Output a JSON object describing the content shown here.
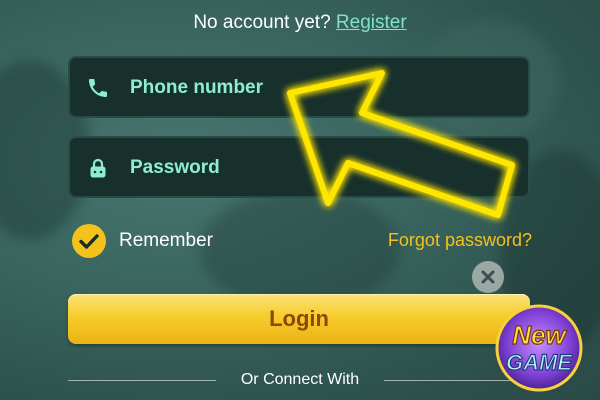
{
  "register": {
    "prompt": "No account yet?",
    "link": "Register"
  },
  "fields": {
    "phone": {
      "placeholder": "Phone number",
      "icon": "phone-icon"
    },
    "password": {
      "placeholder": "Password",
      "icon": "lock-icon"
    }
  },
  "remember": {
    "label": "Remember",
    "checked": true
  },
  "forgot": "Forgot password?",
  "login": "Login",
  "divider": "Or Connect With",
  "logo": {
    "line1": "New",
    "line2": "GAME"
  },
  "colors": {
    "accent_teal": "#8eeed3",
    "accent_yellow": "#f4c21b",
    "field_bg": "#17302c",
    "arrow_glow": "#ffe600"
  }
}
